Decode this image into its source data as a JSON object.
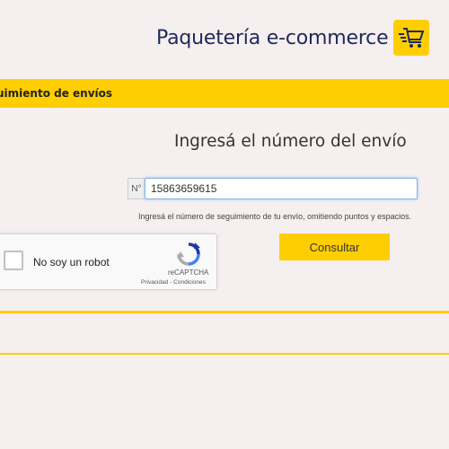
{
  "header": {
    "brand_title": "Paquetería e-commerce",
    "brand_icon": "cart-icon",
    "accent_color": "#ffce00",
    "title_color": "#1e2a5a"
  },
  "section": {
    "title": "uimiento de envíos"
  },
  "form": {
    "heading": "Ingresá el número del envío",
    "prefix": "N°",
    "tracking_value": "15863659615",
    "hint": "Ingresá el número de seguimiento de tu envío, omitiendo puntos y espacios.",
    "submit_label": "Consultar"
  },
  "captcha": {
    "label": "No soy un robot",
    "brand": "reCAPTCHA",
    "privacy": "Privacidad",
    "separator": " - ",
    "terms": "Condiciones",
    "checked": false
  }
}
